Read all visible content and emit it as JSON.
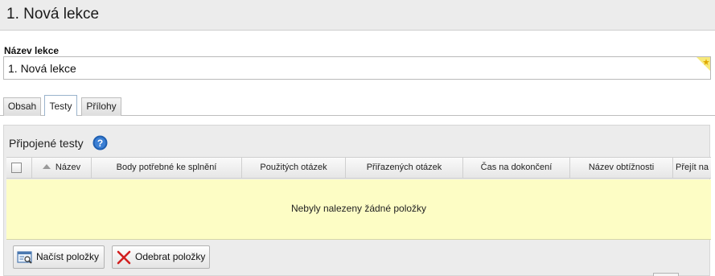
{
  "header": {
    "title": "1. Nová lekce"
  },
  "form": {
    "name_label": "Název lekce",
    "name_value": "1. Nová lekce",
    "required_icon": "star-icon"
  },
  "tabs": [
    {
      "label": "Obsah",
      "active": false
    },
    {
      "label": "Testy",
      "active": true
    },
    {
      "label": "Přílohy",
      "active": false
    }
  ],
  "panel": {
    "title": "Připojené testy",
    "help_icon": "help-icon",
    "columns": [
      "Název",
      "Body potřebné ke splnění",
      "Použitých otázek",
      "Přiřazených otázek",
      "Čas na dokončení",
      "Název obtížnosti",
      "Přejít na"
    ],
    "sort_icon": "sort-asc-icon",
    "empty_message": "Nebyly nalezeny žádné položky",
    "buttons": {
      "load_label": "Načíst položky",
      "load_icon": "load-items-icon",
      "remove_label": "Odebrat položky",
      "remove_icon": "red-x-icon"
    }
  },
  "colors": {
    "empty_row_bg": "#fdfdc5",
    "panel_bg": "#ececec",
    "remove_icon": "#d21f1f",
    "help_icon": "#1f5fb0"
  }
}
